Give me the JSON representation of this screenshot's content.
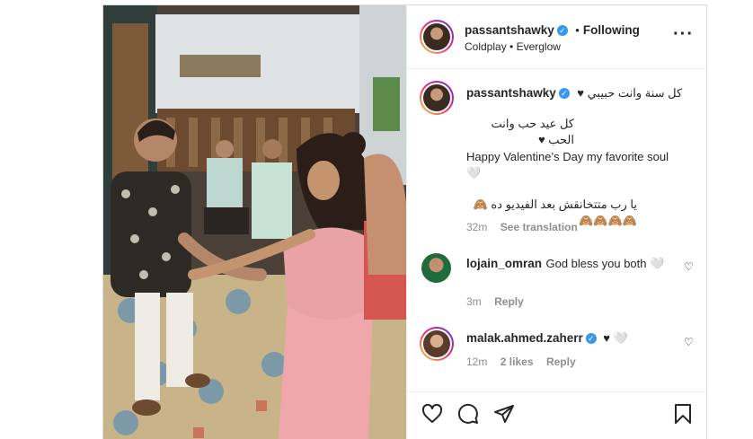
{
  "post": {
    "author": "passantshawky",
    "following_label": "Following",
    "audio": "Coldplay • Everglow",
    "more_icon": "more-horizontal-icon"
  },
  "caption": {
    "username": "passantshawky",
    "line1": "كل سنة وانت حبيبي ♥",
    "line2": "كل عيد حب وانت الحب ♥",
    "line3": "Happy Valentine’s Day my favorite soul 🤍",
    "line4": "يا رب متتخانقش بعد الفيديو ده 🙈🙈🙈🙈🙈",
    "time": "32m",
    "see_translation": "See translation"
  },
  "comments": [
    {
      "username": "lojain_omran",
      "text": "God bless you both 🤍",
      "time": "3m",
      "reply": "Reply",
      "likes": ""
    },
    {
      "username": "malak.ahmed.zaherr",
      "text": "♥ 🤍",
      "time": "12m",
      "likes": "2 likes",
      "reply": "Reply"
    }
  ],
  "icons": [
    "heart-icon",
    "comment-icon",
    "share-icon",
    "bookmark-icon"
  ]
}
